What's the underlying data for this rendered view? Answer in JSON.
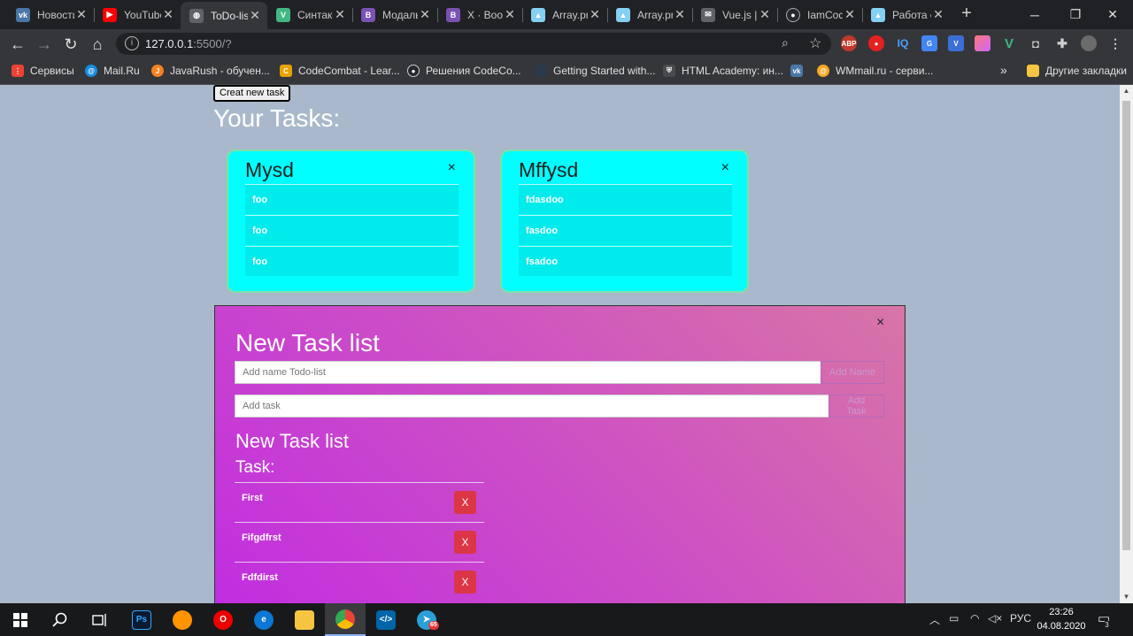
{
  "browser": {
    "tabs": [
      {
        "title": "Новости",
        "icon": "vk-icon",
        "color": "#4a76a8",
        "glyph": "vk"
      },
      {
        "title": "YouTube",
        "icon": "youtube-icon",
        "color": "#ff0000",
        "glyph": "▶"
      },
      {
        "title": "ToDo-list",
        "icon": "globe-icon",
        "color": "#5f6368",
        "glyph": "◍",
        "active": true
      },
      {
        "title": "Синтаксис",
        "icon": "vue-icon",
        "color": "#41b883",
        "glyph": "V"
      },
      {
        "title": "Модальное",
        "icon": "bootstrap-icon",
        "color": "#7952b3",
        "glyph": "B"
      },
      {
        "title": "X · Bootstrap",
        "icon": "bootstrap-icon",
        "color": "#7952b3",
        "glyph": "B"
      },
      {
        "title": "Array.prototype",
        "icon": "mdn-icon",
        "color": "#83d0f2",
        "glyph": "▲"
      },
      {
        "title": "Array.prototype",
        "icon": "mdn-icon",
        "color": "#83d0f2",
        "glyph": "▲"
      },
      {
        "title": "Vue.js | ",
        "icon": "mail-icon",
        "color": "#5f6368",
        "glyph": "✉"
      },
      {
        "title": "IamCoder",
        "icon": "github-icon",
        "color": "#24292e",
        "glyph": "●"
      },
      {
        "title": "Работа с",
        "icon": "mdn-icon",
        "color": "#83d0f2",
        "glyph": "▲"
      }
    ],
    "url_host": "127.0.0.1",
    "url_rest": ":5500/?",
    "bookmarks": [
      {
        "label": "Сервисы",
        "icon": "apps-grid-icon",
        "color": "#ea4335",
        "glyph": "⋮"
      },
      {
        "label": "Mail.Ru",
        "icon": "mailru-icon",
        "color": "#168de2",
        "glyph": "@"
      },
      {
        "label": "JavaRush - обучен...",
        "icon": "javarush-icon",
        "color": "#f58220",
        "glyph": "J"
      },
      {
        "label": "CodeCombat - Lear...",
        "icon": "codecombat-icon",
        "color": "#e6a100",
        "glyph": "C"
      },
      {
        "label": "Решения CodeCo...",
        "icon": "github-icon",
        "color": "#24292e",
        "glyph": "●"
      },
      {
        "label": "Getting Started with...",
        "icon": "doc-icon",
        "color": "#2b3a4a",
        "glyph": " "
      },
      {
        "label": "HTML Academy: ин...",
        "icon": "shield-icon",
        "color": "#4a4b4f",
        "glyph": "⛨"
      },
      {
        "label": "",
        "icon": "vk-icon",
        "color": "#4a76a8",
        "glyph": "vk"
      },
      {
        "label": "WMmail.ru - серви...",
        "icon": "wmmail-icon",
        "color": "#f5a623",
        "glyph": "@"
      }
    ],
    "other_bookmarks": "Другие закладки",
    "more_bookmarks": "»"
  },
  "page": {
    "create_button": "Creat new task",
    "your_tasks_title": "Your Tasks:",
    "cards": [
      {
        "title": "Mysd",
        "close": "×",
        "items": [
          "foo",
          "foo",
          "foo"
        ]
      },
      {
        "title": "Mffysd",
        "close": "×",
        "items": [
          "fdasdoo",
          "fasdoo",
          "fsadoo"
        ]
      }
    ]
  },
  "modal": {
    "close": "×",
    "title": "New Task list",
    "name_placeholder": "Add name Todo-list",
    "name_button": "Add Name",
    "task_placeholder": "Add task",
    "task_button": "Add Task",
    "list_title": "New Task list",
    "task_label": "Task:",
    "tasks": [
      {
        "name": "First",
        "delete": "X"
      },
      {
        "name": "Fifgdfrst",
        "delete": "X"
      },
      {
        "name": "Fdfdirst",
        "delete": "X"
      }
    ]
  },
  "taskbar": {
    "language": "РУС",
    "time": "23:26",
    "date": "04.08.2020",
    "notifications": "3",
    "telegram_badge": "65"
  }
}
